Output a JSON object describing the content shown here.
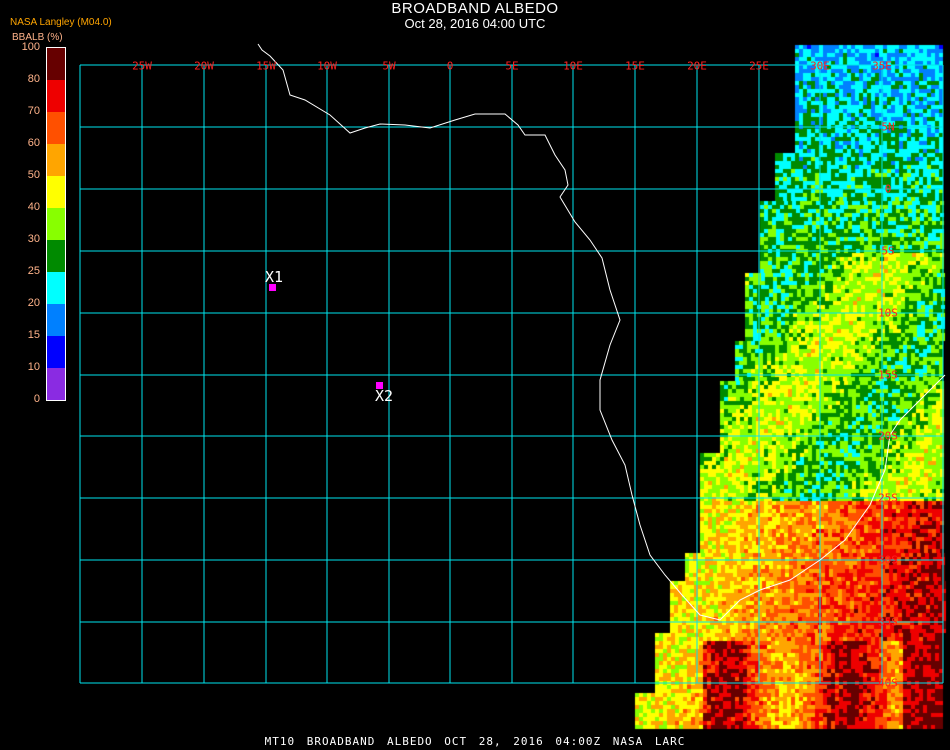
{
  "header": {
    "title": "BROADBAND ALBEDO",
    "subtitle": "Oct 28, 2016 04:00 UTC",
    "source": "NASA Langley (M04.0)",
    "unit_label": "BBALB (%)"
  },
  "colorbar": {
    "ticks": [
      "100",
      "80",
      "70",
      "60",
      "50",
      "40",
      "30",
      "25",
      "20",
      "15",
      "10",
      "0"
    ],
    "colors": [
      "#660000",
      "#ee0000",
      "#ff5000",
      "#ffa500",
      "#ffff00",
      "#88ff00",
      "#008a00",
      "#00ffff",
      "#0080ff",
      "#0000ff",
      "#8a2be2"
    ]
  },
  "map": {
    "lon_labels": [
      "25W",
      "20W",
      "15W",
      "10W",
      "5W",
      "0",
      "5E",
      "10E",
      "15E",
      "20E",
      "25E",
      "30E",
      "35E"
    ],
    "lat_labels": [
      "5N",
      "0",
      "5S",
      "10S",
      "15S",
      "20S",
      "25S",
      "30S",
      "35S",
      "40S"
    ],
    "grid_color": "#00e5ee",
    "markers": [
      {
        "label": "X1",
        "color": "#ff00ff"
      },
      {
        "label": "X2",
        "color": "#ff00ff"
      }
    ]
  },
  "footer": {
    "text": "MT10  BROADBAND ALBEDO  OCT 28, 2016 04:00Z  NASA LARC"
  }
}
